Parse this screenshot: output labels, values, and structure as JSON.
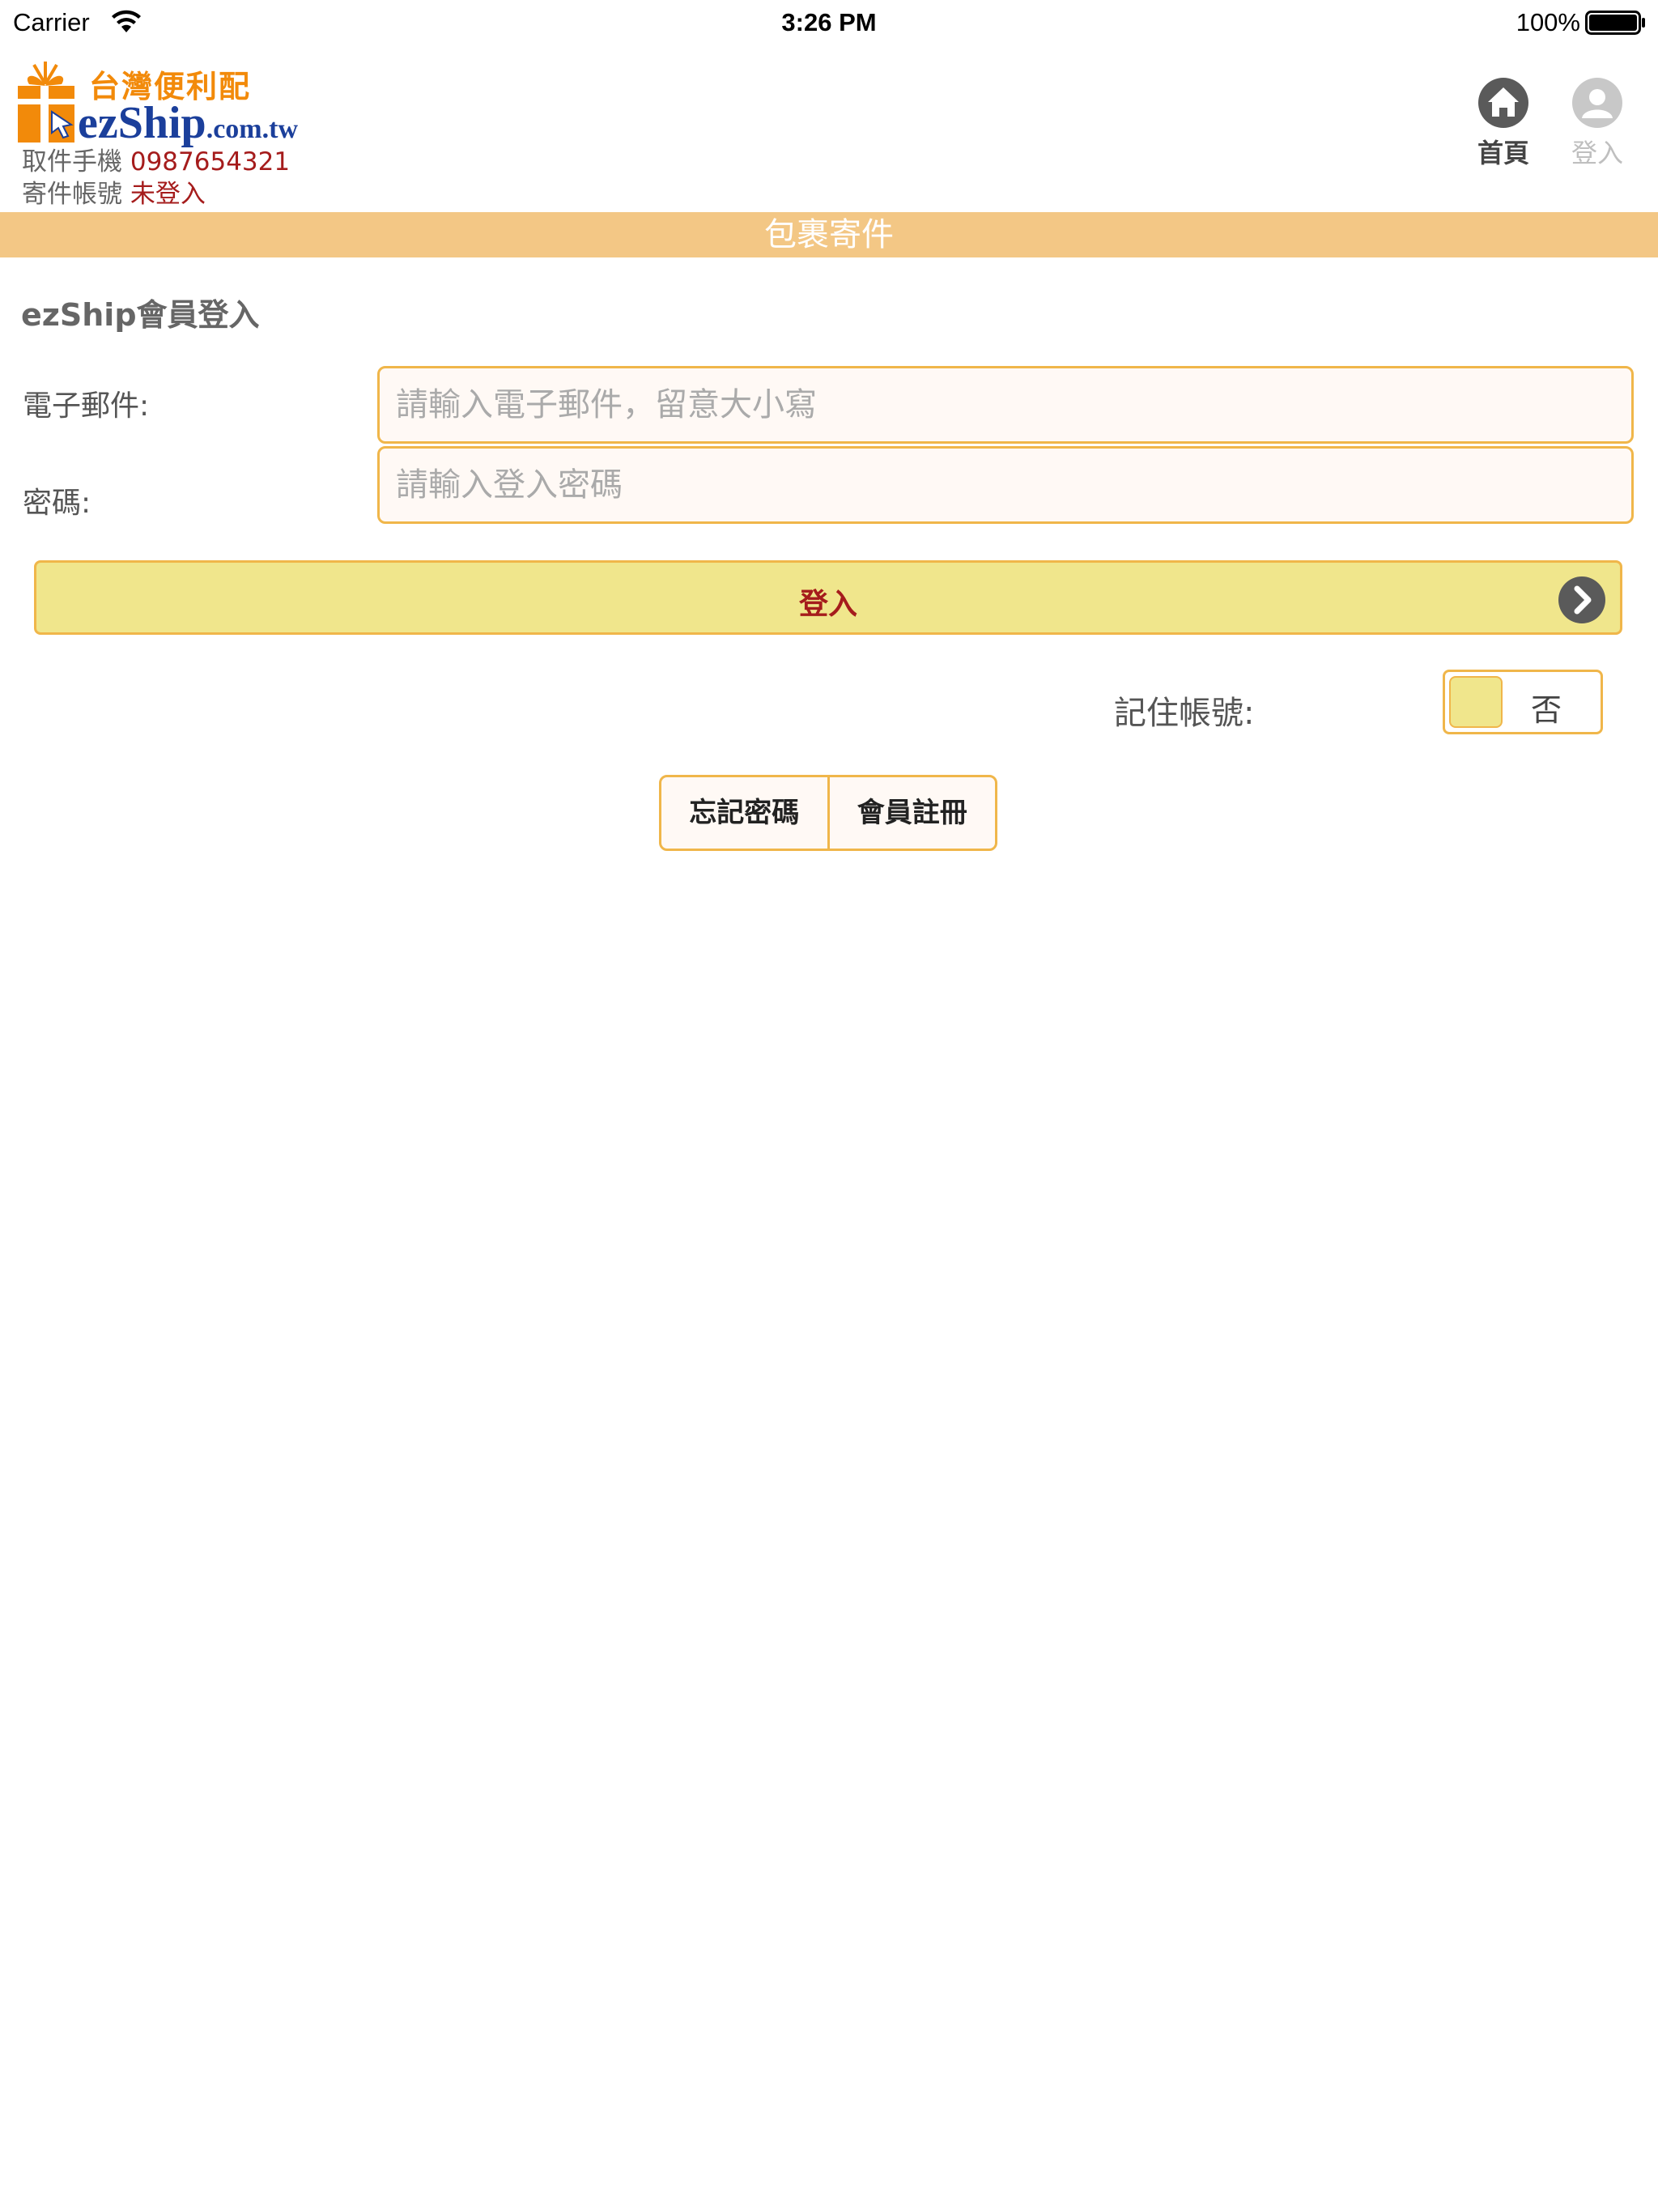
{
  "status_bar": {
    "carrier": "Carrier",
    "time": "3:26 PM",
    "battery": "100%"
  },
  "header": {
    "logo_cn": "台灣便利配",
    "logo_en_main": "ezShip",
    "logo_en_suffix": ".com.tw",
    "pickup_phone_label": "取件手機",
    "pickup_phone_value": "0987654321",
    "sender_account_label": "寄件帳號",
    "sender_account_value": "未登入",
    "nav": {
      "home_label": "首頁",
      "login_label": "登入"
    }
  },
  "banner": {
    "title": "包裹寄件"
  },
  "form": {
    "title": "ezShip會員登入",
    "email_label": "電子郵件:",
    "email_placeholder": "請輸入電子郵件，留意大小寫",
    "email_value": "",
    "password_label": "密碼:",
    "password_placeholder": "請輸入登入密碼",
    "password_value": "",
    "login_button_label": "登入",
    "remember_label": "記住帳號:",
    "remember_value": "否",
    "forgot_password_label": "忘記密碼",
    "register_label": "會員註冊"
  },
  "colors": {
    "accent_orange": "#f0b64a",
    "banner": "#f3c785",
    "button_yellow": "#f0e68c",
    "value_red": "#a51c1c",
    "logo_orange": "#f28a0a",
    "logo_blue": "#1b3f9b"
  }
}
